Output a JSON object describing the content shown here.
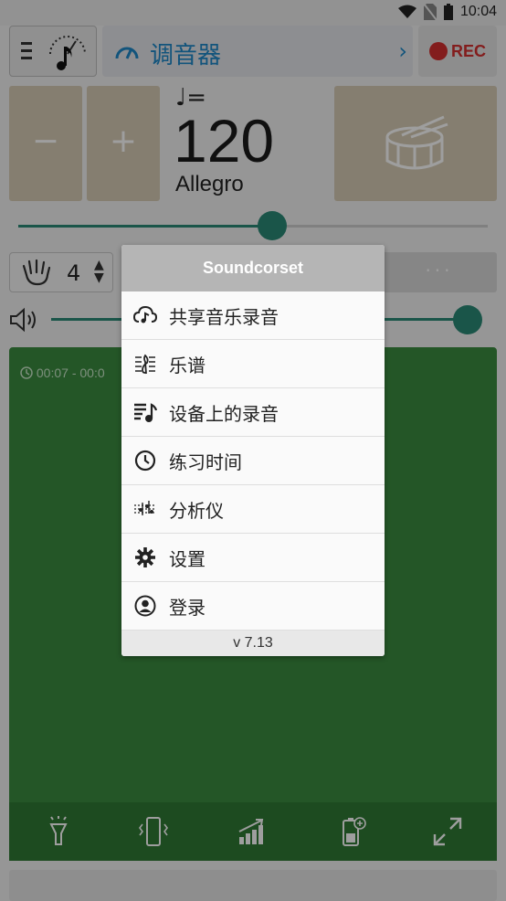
{
  "status_bar": {
    "time": "10:04"
  },
  "header": {
    "tuner_label": "调音器",
    "rec_label": "REC"
  },
  "tempo": {
    "minus": "−",
    "plus": "+",
    "note_symbol": "♩=",
    "bpm": "120",
    "name": "Allegro",
    "slider_fraction": 0.54
  },
  "beats": {
    "value": "4",
    "more": "···"
  },
  "volume": {
    "fraction": 0.97
  },
  "panel": {
    "timer": "00:07 - 00:0"
  },
  "menu": {
    "title": "Soundcorset",
    "items": [
      {
        "label": "共享音乐录音",
        "icon": "cloud-music-icon"
      },
      {
        "label": "乐谱",
        "icon": "sheet-music-icon"
      },
      {
        "label": "设备上的录音",
        "icon": "recordings-list-icon"
      },
      {
        "label": "练习时间",
        "icon": "clock-icon"
      },
      {
        "label": "分析仪",
        "icon": "analyzer-icon"
      },
      {
        "label": "设置",
        "icon": "gear-icon"
      },
      {
        "label": "登录",
        "icon": "account-icon"
      }
    ],
    "version": "v 7.13"
  },
  "colors": {
    "accent": "#2b8a76",
    "tuner_blue": "#1e88c8",
    "rec_red": "#d32f2f",
    "panel_green": "#3b8c3f",
    "tile": "#d7ccb5"
  }
}
